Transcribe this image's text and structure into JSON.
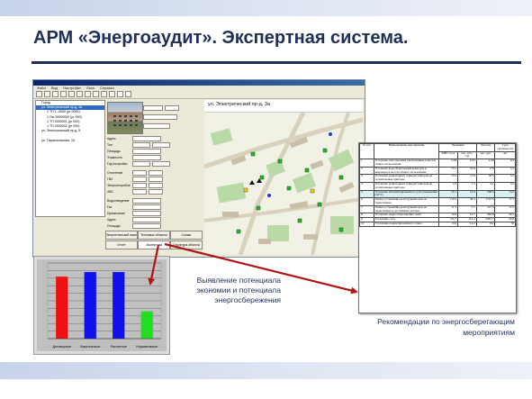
{
  "slide": {
    "title": "АРМ «Энергоаудит». Экспертная система.",
    "caption_left": "Выявление потенциала экономии и потенциала энергосбережения",
    "caption_right": "Рекомендации по энергосберегающим мероприятиям",
    "colors": {
      "title": "#1f2f57",
      "arrow": "#b01515",
      "band": "#c7d3ea"
    }
  },
  "app": {
    "menu": [
      "Файл",
      "Вид",
      "Настройки",
      "Окно",
      "Справка"
    ],
    "map_header": "ул. Электрический пр-д, 3а",
    "tree": [
      "Город",
      "ул. Электрический пр-д, 3а",
      "1 ТП 1 -0000 (рг 0000)",
      "1 Ож 00000000 (рг 000)",
      "1 ТП 0000001 (рг 000)",
      "1 ТП 0000002 (рг 000)",
      "ул. Электрический пр-д, 5",
      "ул. Тираспольская, 33"
    ],
    "tabs": [
      "Энергетический паспорт",
      "Тепловые объекты",
      "Схемы",
      "Отчёт",
      "Экспертиза",
      "Структура объекта"
    ],
    "form_labels": [
      "Адрес",
      "Тип",
      "Площадь",
      "Этажность",
      "Год постройки",
      "Отопление",
      "ГВС",
      "Энергопотребление",
      "ХВС",
      "Водоотведение",
      "Газ",
      "Примечание"
    ]
  },
  "chart_data": {
    "type": "bar",
    "title": "",
    "categories": [
      "Договорное",
      "Фактическое",
      "Расчетное",
      "Нормативное"
    ],
    "values": [
      82,
      88,
      88,
      36
    ],
    "series_colors": [
      "#ee1111",
      "#1010ee",
      "#1010ee",
      "#22dd22"
    ],
    "ylim": [
      0,
      100
    ],
    "grid": true,
    "xlabel": "",
    "ylabel": ""
  },
  "measures_table": {
    "headers": [
      "№ п/п",
      "Наименование мероприятия",
      "Экономия",
      "Затраты",
      "Срок окупаемости"
    ],
    "subheaders": [
      "МВт·ч/год",
      "тыс. руб./год",
      "тыс. руб.",
      "лет"
    ],
    "rows": [
      [
        "1",
        "Установка светодиодных светильников в местах общего пользования",
        "2.38",
        "6.35",
        "2.46",
        "0.4"
      ],
      [
        "2",
        "Установка водосберегающей арматуры в квартирах и местах общего пользования",
        "73.1",
        "31.9",
        "170",
        "5.3"
      ],
      [
        "3",
        "Установка радиаторных терморегуляторов на отопительные приборы",
        "13.5",
        "11.9",
        "38.5",
        "3.2"
      ],
      [
        "4",
        "Установка радиаторных терморегуляторов на отопительные приборы",
        "3.3",
        "1.2",
        "4.1",
        "3.2"
      ],
      [
        "5",
        "Установка автоматизированного узла управления (АУУ)",
        "23.1",
        "14.4",
        "258.4",
        "13.5"
      ],
      [
        "6",
        "Замена устаревших конструкций окон на герметичные",
        "114.5",
        "40.4",
        "1722.5",
        "17.3"
      ],
      [
        "7",
        "Замена устаревших конструкций окон на герметичные в лестничных клетках",
        "11.3",
        "3.7",
        "127.3",
        "17.5"
      ],
      [
        "8",
        "Установка энергосберегающих ламп",
        "14.9",
        "12.7",
        "582.6",
        "26.3"
      ],
      [
        "9",
        "Утепление стен",
        "131.7",
        "112.4",
        "4481.7",
        "40.8"
      ],
      [
        "10",
        "Утепление покрытий верхнего этажа",
        "13.9",
        "12.2",
        "332",
        "32"
      ]
    ]
  }
}
